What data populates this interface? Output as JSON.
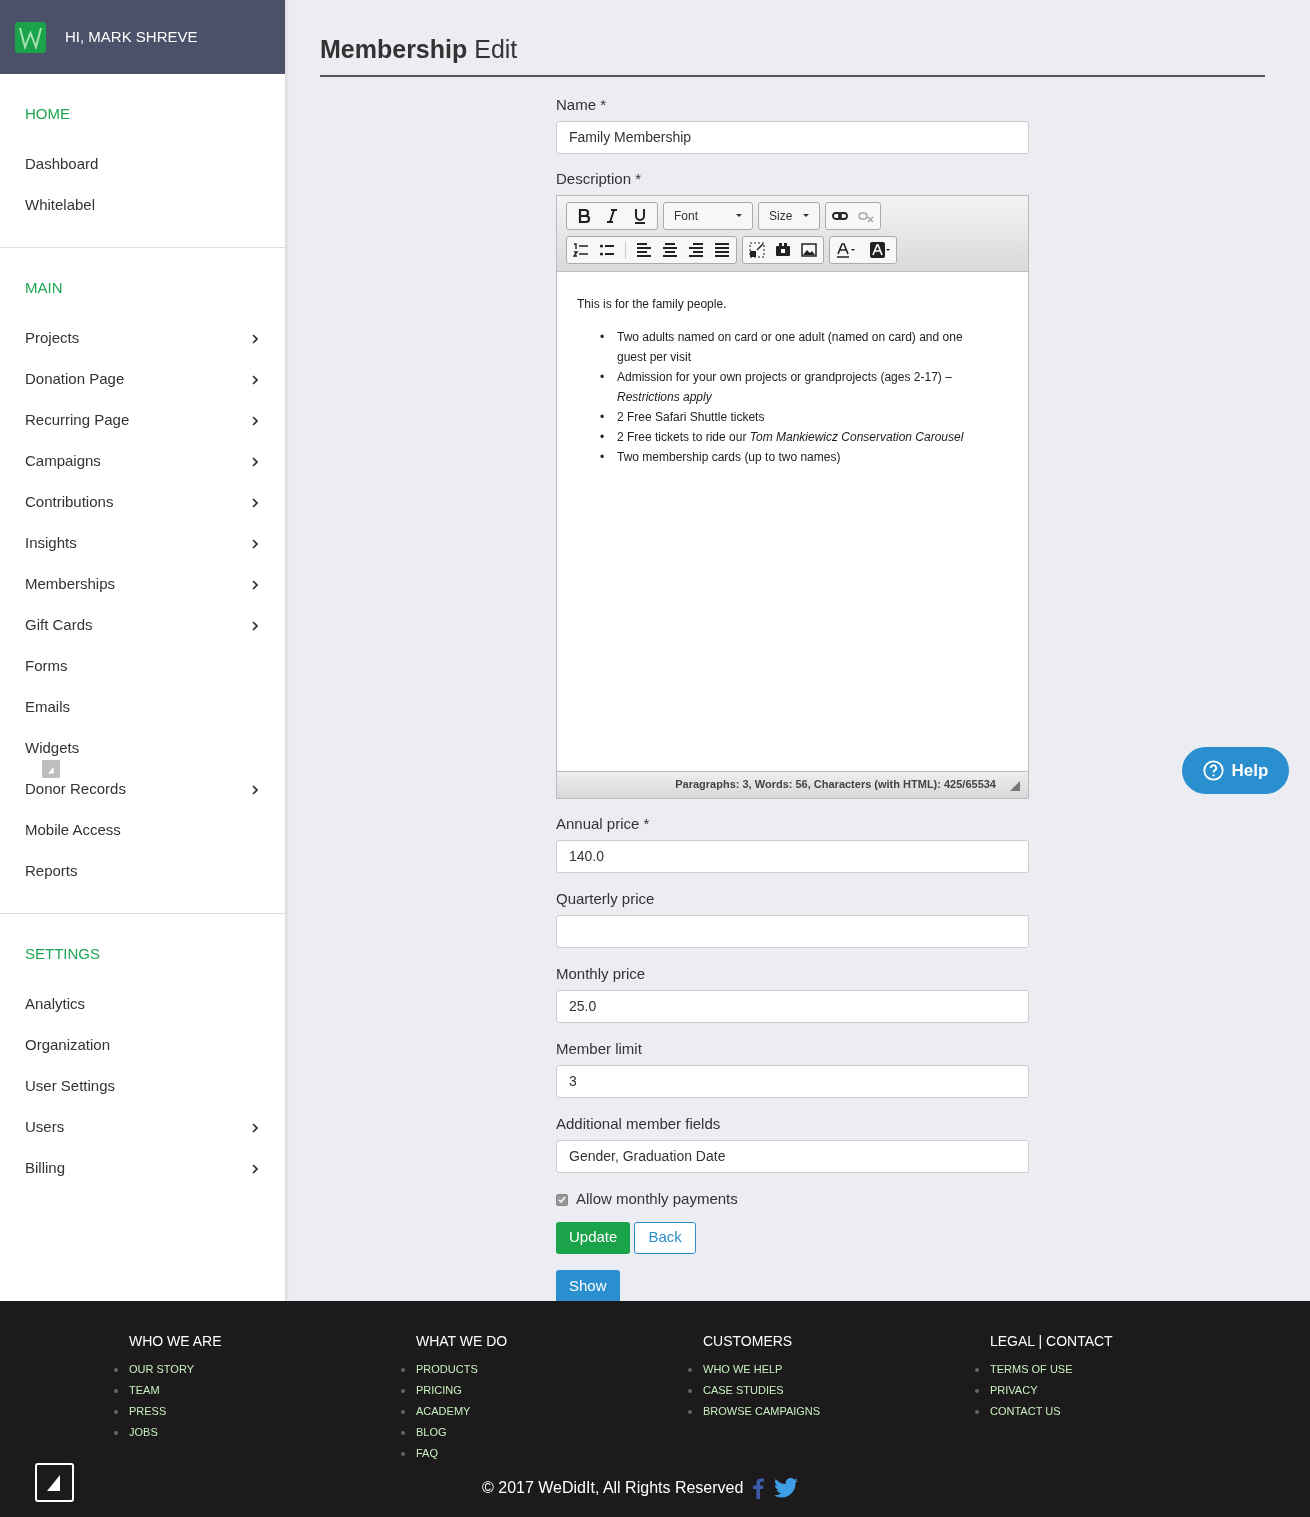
{
  "user_header": {
    "greeting": "HI, MARK SHREVE"
  },
  "sidebar": {
    "sections": [
      {
        "heading": "HOME",
        "items": [
          {
            "label": "Dashboard",
            "has_submenu": false
          },
          {
            "label": "Whitelabel",
            "has_submenu": false
          }
        ]
      },
      {
        "heading": "MAIN",
        "items": [
          {
            "label": "Projects",
            "has_submenu": true
          },
          {
            "label": "Donation Page",
            "has_submenu": true
          },
          {
            "label": "Recurring Page",
            "has_submenu": true
          },
          {
            "label": "Campaigns",
            "has_submenu": true
          },
          {
            "label": "Contributions",
            "has_submenu": true
          },
          {
            "label": "Insights",
            "has_submenu": true
          },
          {
            "label": "Memberships",
            "has_submenu": true
          },
          {
            "label": "Gift Cards",
            "has_submenu": true
          },
          {
            "label": "Forms",
            "has_submenu": false
          },
          {
            "label": "Emails",
            "has_submenu": false
          },
          {
            "label": "Widgets",
            "has_submenu": false
          },
          {
            "label": "Donor Records",
            "has_submenu": true
          },
          {
            "label": "Mobile Access",
            "has_submenu": false
          },
          {
            "label": "Reports",
            "has_submenu": false
          }
        ]
      },
      {
        "heading": "SETTINGS",
        "items": [
          {
            "label": "Analytics",
            "has_submenu": false
          },
          {
            "label": "Organization",
            "has_submenu": false
          },
          {
            "label": "User Settings",
            "has_submenu": false
          },
          {
            "label": "Users",
            "has_submenu": true
          },
          {
            "label": "Billing",
            "has_submenu": true
          }
        ]
      }
    ]
  },
  "page_title": "**Membership** Edit",
  "form": {
    "name_field": {
      "label": "Name *",
      "value": "Family Membership"
    },
    "description": {
      "label": "Description *",
      "font_dropdown": "Font",
      "size_dropdown": "Size",
      "intro": "This is for the family people.",
      "bullet_marker": "•",
      "bullets": [
        "Two adults named on card or one adult (named on card) and one guest per visit",
        "Admission for your own projects or grandprojects (ages 2-17) – *Restrictions apply*",
        "2 Free Safari Shuttle tickets",
        "2 Free tickets to ride our *Tom Mankiewicz Conservation Carousel*",
        "Two membership cards (up to two names)"
      ],
      "status": "Paragraphs: 3, Words: 56, Characters (with HTML): 425/65534"
    },
    "fields": [
      {
        "label": "Annual price *",
        "value": "140.0"
      },
      {
        "label": "Quarterly price"
      },
      {
        "label": "Monthly price",
        "value": "25.0"
      },
      {
        "label": "Member limit",
        "value": "3"
      },
      {
        "label": "Additional member fields",
        "value": "Gender, Graduation Date"
      }
    ],
    "allow_monthly": {
      "label": "Allow monthly payments",
      "checked": true
    },
    "buttons": {
      "update": "Update",
      "back": "Back",
      "show": "Show"
    }
  },
  "help_button": "Help",
  "footer": {
    "columns": [
      {
        "heading": "WHO WE ARE",
        "links": [
          "OUR STORY",
          "TEAM",
          "PRESS",
          "JOBS"
        ]
      },
      {
        "heading": "WHAT WE DO",
        "links": [
          "PRODUCTS",
          "PRICING",
          "ACADEMY",
          "BLOG",
          "FAQ"
        ]
      },
      {
        "heading": "CUSTOMERS",
        "links": [
          "WHO WE HELP",
          "CASE STUDIES",
          "BROWSE CAMPAIGNS"
        ]
      },
      {
        "heading": "LEGAL | CONTACT",
        "links": [
          "TERMS OF USE",
          "PRIVACY",
          "CONTACT US"
        ]
      }
    ],
    "copyright": "© 2017 WeDidIt, All Rights Reserved"
  }
}
